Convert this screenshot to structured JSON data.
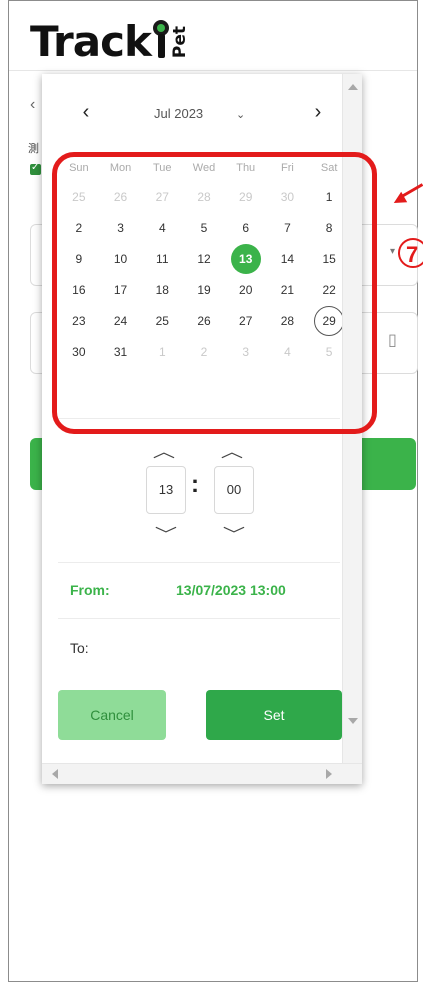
{
  "app": {
    "logo_text": "Track",
    "logo_sub": "Pet"
  },
  "background": {
    "label_fragment": "測"
  },
  "calendar": {
    "month_label": "Jul 2023",
    "weekdays": [
      "Sun",
      "Mon",
      "Tue",
      "Wed",
      "Thu",
      "Fri",
      "Sat"
    ],
    "days": [
      {
        "d": "25",
        "muted": true
      },
      {
        "d": "26",
        "muted": true
      },
      {
        "d": "27",
        "muted": true
      },
      {
        "d": "28",
        "muted": true
      },
      {
        "d": "29",
        "muted": true
      },
      {
        "d": "30",
        "muted": true
      },
      {
        "d": "1"
      },
      {
        "d": "2"
      },
      {
        "d": "3"
      },
      {
        "d": "4"
      },
      {
        "d": "5"
      },
      {
        "d": "6"
      },
      {
        "d": "7"
      },
      {
        "d": "8"
      },
      {
        "d": "9"
      },
      {
        "d": "10"
      },
      {
        "d": "11"
      },
      {
        "d": "12"
      },
      {
        "d": "13",
        "selected": true
      },
      {
        "d": "14"
      },
      {
        "d": "15"
      },
      {
        "d": "16"
      },
      {
        "d": "17"
      },
      {
        "d": "18"
      },
      {
        "d": "19"
      },
      {
        "d": "20"
      },
      {
        "d": "21"
      },
      {
        "d": "22"
      },
      {
        "d": "23"
      },
      {
        "d": "24"
      },
      {
        "d": "25"
      },
      {
        "d": "26"
      },
      {
        "d": "27"
      },
      {
        "d": "28"
      },
      {
        "d": "29",
        "today": true
      },
      {
        "d": "30"
      },
      {
        "d": "31"
      },
      {
        "d": "1",
        "muted": true
      },
      {
        "d": "2",
        "muted": true
      },
      {
        "d": "3",
        "muted": true
      },
      {
        "d": "4",
        "muted": true
      },
      {
        "d": "5",
        "muted": true
      }
    ]
  },
  "time": {
    "hour": "13",
    "minute": "00",
    "separator": ":"
  },
  "range": {
    "from_label": "From:",
    "from_value": "13/07/2023 13:00",
    "to_label": "To:",
    "to_value": ""
  },
  "buttons": {
    "cancel": "Cancel",
    "set": "Set"
  },
  "annotation": {
    "step_number": "7",
    "color": "#e31b1b"
  },
  "colors": {
    "accent": "#3bb34a",
    "cancel_bg": "#8fdc98"
  }
}
